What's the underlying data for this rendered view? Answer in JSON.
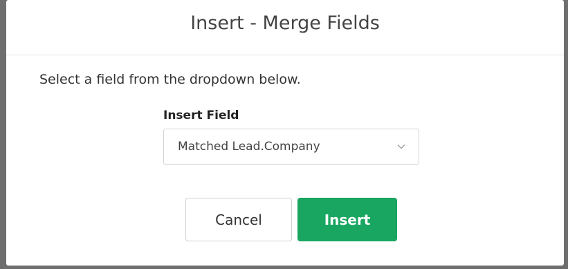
{
  "dialog": {
    "title": "Insert - Merge Fields",
    "instructions": "Select a field from the dropdown below.",
    "field_label": "Insert Field",
    "select": {
      "selected_value": "Matched Lead.Company",
      "icon": "chevron-down-icon"
    },
    "buttons": {
      "cancel_label": "Cancel",
      "insert_label": "Insert"
    }
  },
  "colors": {
    "primary": "#18a661",
    "backdrop": "#6e6e6e",
    "text": "#333333"
  }
}
